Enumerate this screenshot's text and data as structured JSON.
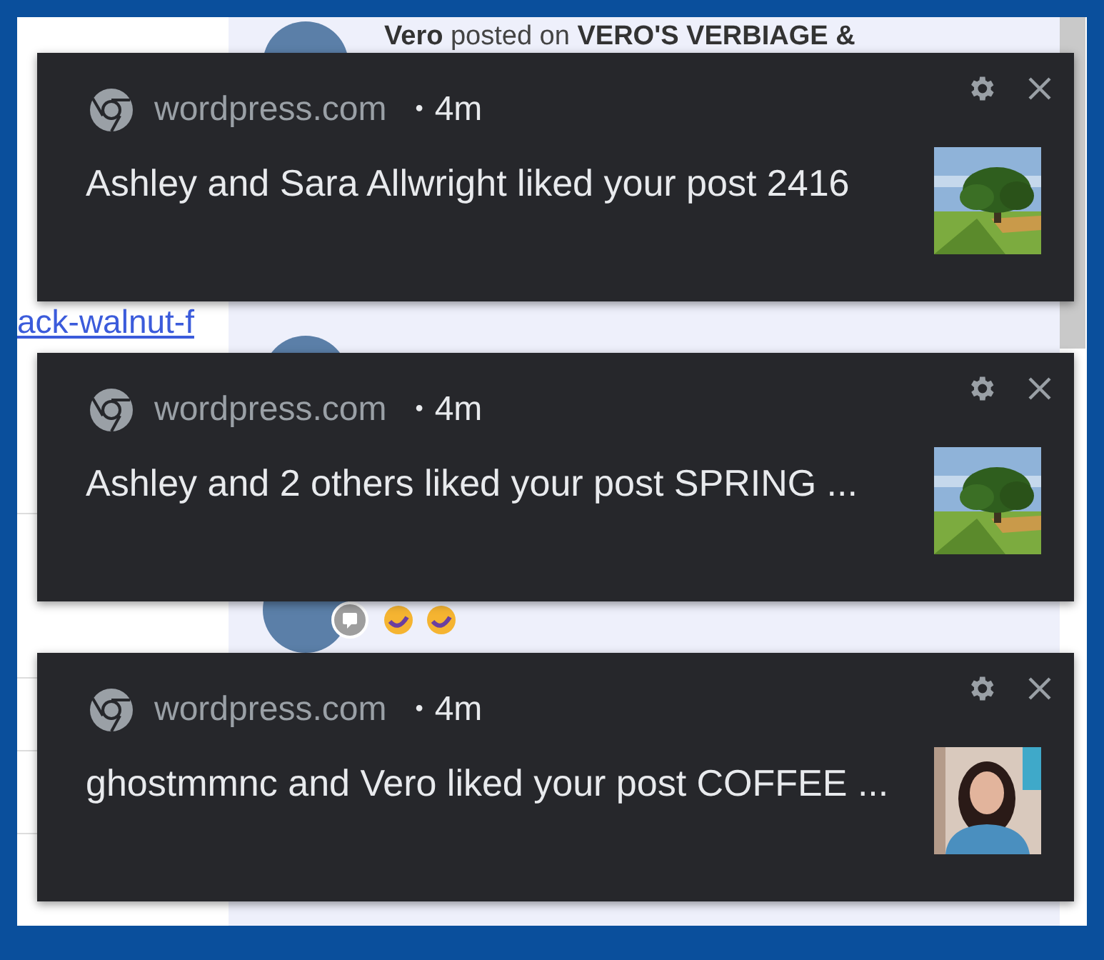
{
  "background": {
    "post": {
      "author": "Vero",
      "verb": "posted on",
      "blog": "VERO'S VERBIAGE &"
    },
    "link": "ack-walnut-f"
  },
  "notifications": [
    {
      "site": "wordpress.com",
      "separator": "•",
      "time": "4m",
      "message": "Ashley and Sara Allwright liked your post 2416"
    },
    {
      "site": "wordpress.com",
      "separator": "•",
      "time": "4m",
      "message": "Ashley and 2 others liked your post SPRING ..."
    },
    {
      "site": "wordpress.com",
      "separator": "•",
      "time": "4m",
      "message": "ghostmmnc and Vero liked your post COFFEE ..."
    }
  ]
}
